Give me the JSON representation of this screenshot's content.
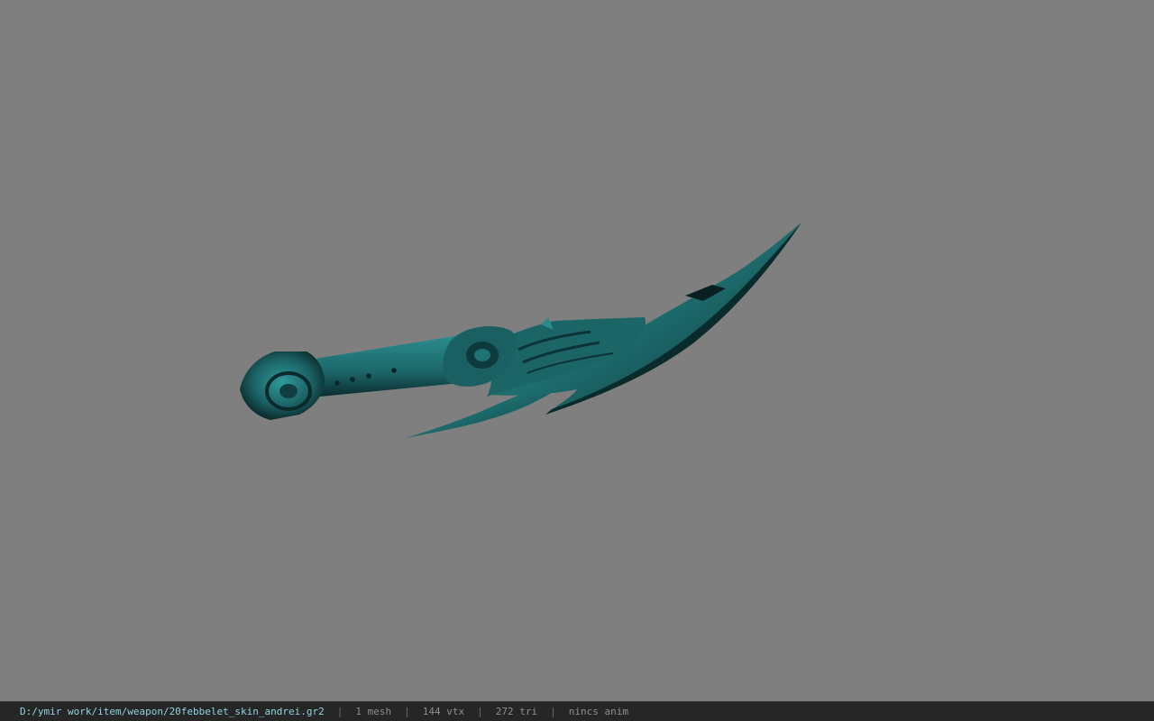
{
  "viewer": {
    "background_color": "#7f7f7f",
    "model": {
      "icon": "curved-dagger-model",
      "color": "#1f6e70"
    }
  },
  "status_bar": {
    "file_path": "D:/ymir work/item/weapon/20febbelet_skin_andrei.gr2",
    "meshes": "1 mesh",
    "vertices": "144 vtx",
    "triangles": "272 tri",
    "animation": "nincs anim",
    "separator": "|"
  }
}
